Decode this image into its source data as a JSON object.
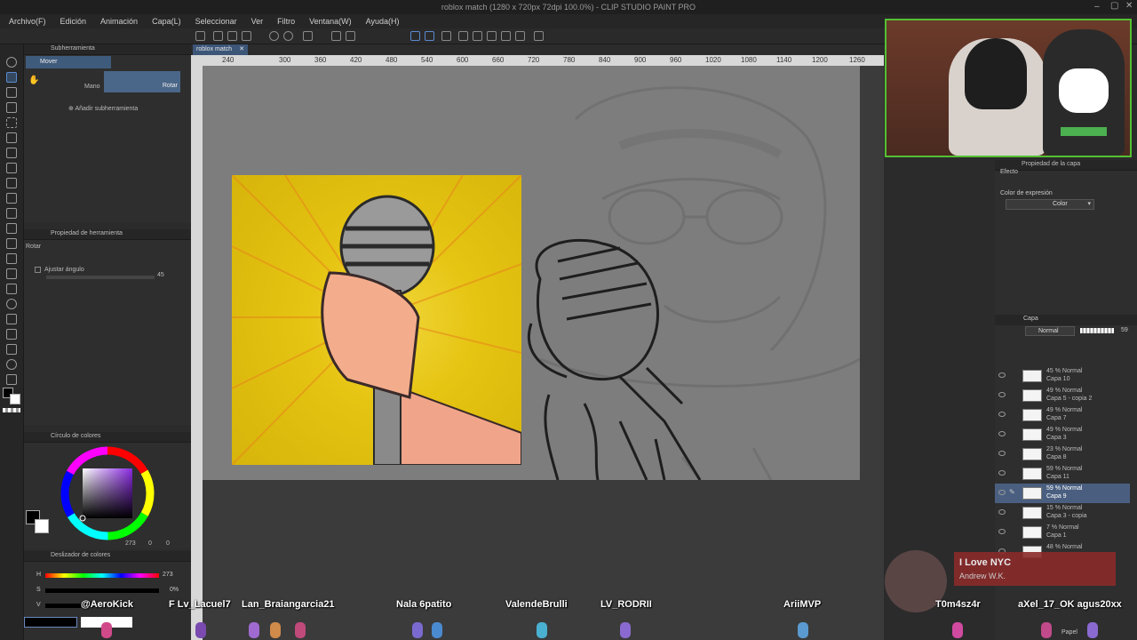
{
  "window": {
    "title": "roblox match (1280 x 720px 72dpi 100.0%) - CLIP STUDIO PAINT PRO"
  },
  "menu": [
    "Archivo(F)",
    "Edición",
    "Animación",
    "Capa(L)",
    "Seleccionar",
    "Ver",
    "Filtro",
    "Ventana(W)",
    "Ayuda(H)"
  ],
  "sub_tool": {
    "header": "Subherramienta",
    "active": "Mover",
    "mode_left": "Mano",
    "mode_right": "Rotar",
    "add_label": "Añadir subherramienta"
  },
  "tool_property": {
    "header": "Propiedad de herramienta",
    "tool_name": "Rotar",
    "option_label": "Ajustar ángulo",
    "option_value": "45"
  },
  "color_wheel": {
    "header": "Círculo de colores",
    "h": "273",
    "s": "0",
    "v": "0"
  },
  "color_slider": {
    "header": "Deslizador de colores",
    "h_label": "H",
    "h_value": "273",
    "s_label": "S",
    "s_value": "0%",
    "v_label": "V"
  },
  "canvas": {
    "tab": "roblox match",
    "ruler_ticks": [
      "240",
      "300",
      "360",
      "420",
      "480",
      "540",
      "600",
      "660",
      "720",
      "780",
      "840",
      "900",
      "960",
      "1020",
      "1080",
      "1140",
      "1200",
      "1260"
    ]
  },
  "layer_property": {
    "header": "Propiedad de la capa",
    "effect_label": "Efecto",
    "expression_label": "Color de expresión",
    "expression_value": "Color"
  },
  "layers": {
    "header": "Capa",
    "blend_mode": "Normal",
    "opacity": "59",
    "items": [
      {
        "l1": "45 % Normal",
        "l2": "Capa 10"
      },
      {
        "l1": "49 % Normal",
        "l2": "Capa 5 - copia 2"
      },
      {
        "l1": "49 % Normal",
        "l2": "Capa 7"
      },
      {
        "l1": "49 % Normal",
        "l2": "Capa 3"
      },
      {
        "l1": "23 % Normal",
        "l2": "Capa 8"
      },
      {
        "l1": "59 % Normal",
        "l2": "Capa 11"
      },
      {
        "l1": "59 % Normal",
        "l2": "Capa 9"
      },
      {
        "l1": "15 % Normal",
        "l2": "Capa 3 - copia"
      },
      {
        "l1": "7 % Normal",
        "l2": "Capa 1"
      },
      {
        "l1": "48 % Normal",
        "l2": ""
      }
    ],
    "paper_label": "Papel"
  },
  "chat_names": [
    "@AeroKick",
    "F Lv_Lacuel7",
    "Lan_Braiangarcia21",
    "Nala 6patito",
    "ValendeBrulli",
    "LV_RODRII",
    "AriiMVP",
    "T0m4sz4r",
    "aXel_17_OK agus20xx"
  ],
  "notification": {
    "title": "I Love NYC",
    "author": "Andrew W.K."
  }
}
